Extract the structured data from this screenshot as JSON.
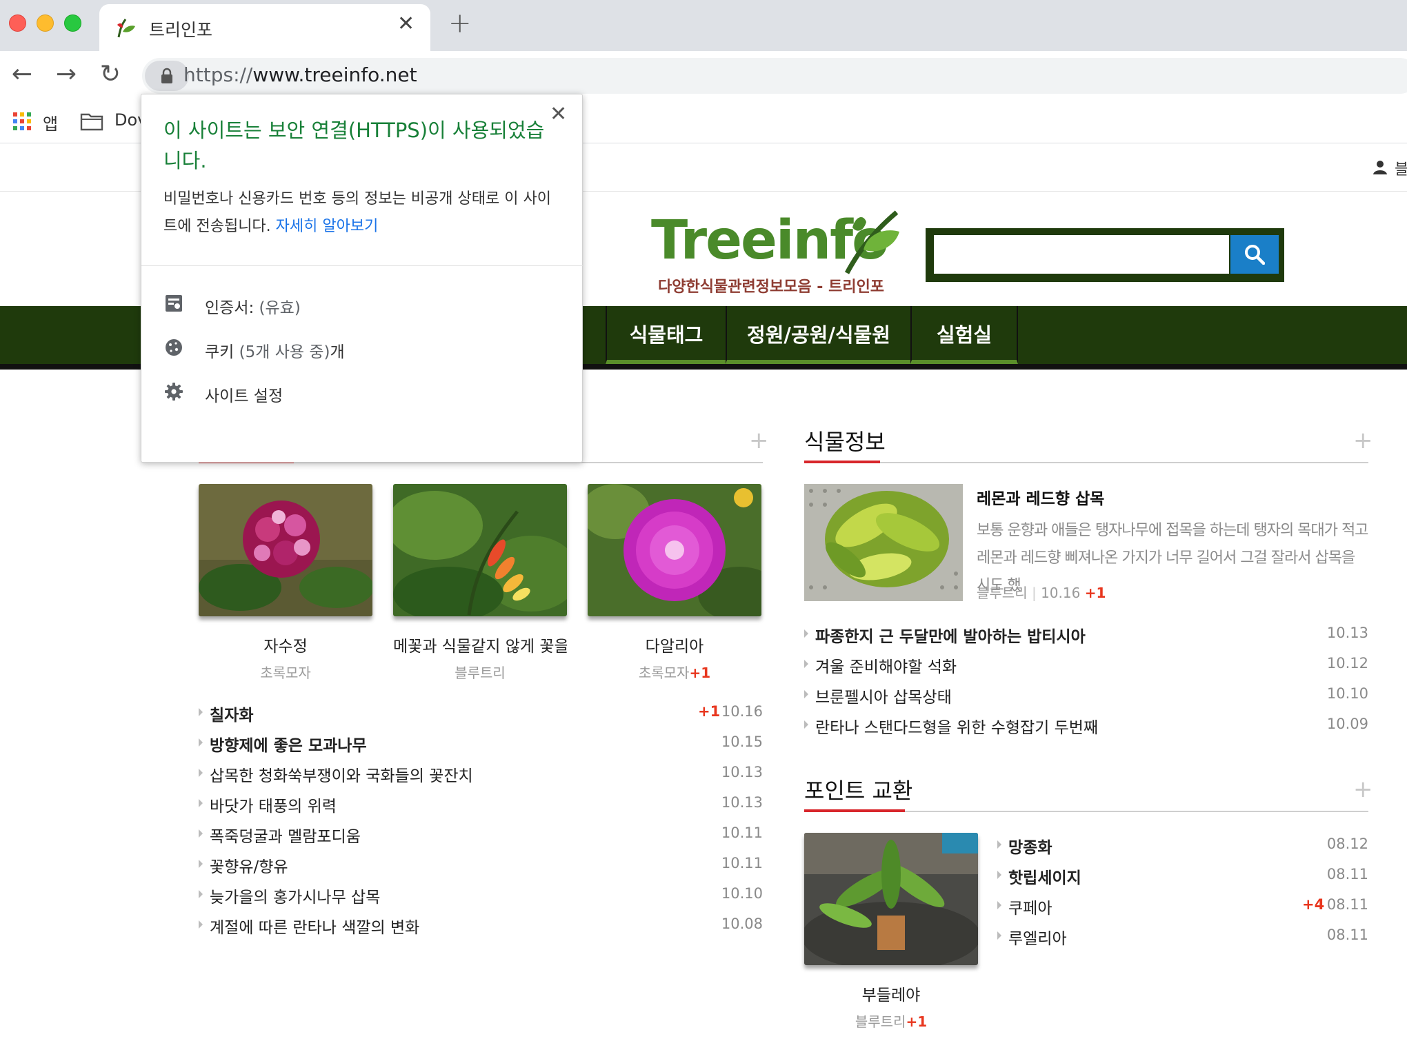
{
  "browser": {
    "tab_title": "트리인포",
    "url_scheme": "https://",
    "url_host": "www.treeinfo.net",
    "bookmarks": [
      {
        "label": "앱"
      },
      {
        "label": "Dov"
      }
    ]
  },
  "site": {
    "user_menu_label": "블",
    "logo_text": "Treeinfo",
    "logo_subtitle": "다양한식물관련정보모음 - 트리인포",
    "search": {
      "placeholder": ""
    },
    "nav": [
      "식물태그",
      "정원/공원/식물원",
      "실험실"
    ],
    "accent_color": "#d8262b",
    "nav_color": "#1f3a0c"
  },
  "left_section": {
    "plus": "+",
    "thumbs": [
      {
        "caption": "자수정",
        "author": "초록모자",
        "extra": ""
      },
      {
        "caption": "메꽃과 식물같지 않게 꽃을 피",
        "author": "블루트리",
        "extra": ""
      },
      {
        "caption": "다알리아",
        "author": "초록모자",
        "extra": "+1"
      }
    ],
    "items": [
      {
        "title": "칠자화",
        "date": "10.16",
        "extra": "+1",
        "bold": true
      },
      {
        "title": "방향제에 좋은 모과나무",
        "date": "10.15",
        "extra": "",
        "bold": true
      },
      {
        "title": "삽목한 청화쑥부쟁이와 국화들의 꽃잔치",
        "date": "10.13",
        "extra": "",
        "bold": false
      },
      {
        "title": "바닷가 태풍의 위력",
        "date": "10.13",
        "extra": "",
        "bold": false
      },
      {
        "title": "폭죽덩굴과 멜람포디움",
        "date": "10.11",
        "extra": "",
        "bold": false
      },
      {
        "title": "꽃향유/향유",
        "date": "10.11",
        "extra": "",
        "bold": false
      },
      {
        "title": "늦가을의 홍가시나무 삽목",
        "date": "10.10",
        "extra": "",
        "bold": false
      },
      {
        "title": "계절에 따른 란타나 색깔의 변화",
        "date": "10.08",
        "extra": "",
        "bold": false
      }
    ]
  },
  "plant_info": {
    "title": "식물정보",
    "plus": "+",
    "featured": {
      "title": "레몬과 레드향 삽목",
      "desc": "보통 운향과 애들은 탱자나무에 접목을 하는데 탱자의 목대가 적고 레몬과 레드향 삐져나온 가지가 너무 길어서 그걸 잘라서 삽목을 시도 했",
      "author": "블루트리",
      "sep": "|",
      "date": "10.16",
      "extra": "+1"
    },
    "items": [
      {
        "title": "파종한지 근 두달만에 발아하는 밥티시아",
        "date": "10.13",
        "bold": true
      },
      {
        "title": "겨울 준비해야할 석화",
        "date": "10.12",
        "bold": false
      },
      {
        "title": "브룬펠시아 삽목상태",
        "date": "10.10",
        "bold": false
      },
      {
        "title": "란타나 스탠다드형을 위한 수형잡기 두번째",
        "date": "10.09",
        "bold": false
      }
    ]
  },
  "points": {
    "title": "포인트 교환",
    "plus": "+",
    "thumb": {
      "caption": "부들레야",
      "author": "블루트리",
      "extra": "+1"
    },
    "items": [
      {
        "title": "망종화",
        "date": "08.12",
        "extra": "",
        "bold": true
      },
      {
        "title": "핫립세이지",
        "date": "08.11",
        "extra": "",
        "bold": true
      },
      {
        "title": "쿠페아",
        "date": "08.11",
        "extra": "+4",
        "bold": false
      },
      {
        "title": "루엘리아",
        "date": "08.11",
        "extra": "",
        "bold": false
      }
    ]
  },
  "security_popup": {
    "heading": "이 사이트는 보안 연결(HTTPS)이 사용되었습니다.",
    "body": "비밀번호나 신용카드 번호 등의 정보는 비공개 상태로 이 사이트에 전송됩니다.",
    "learn_more": "자세히 알아보기",
    "certificate_label": "인증서:",
    "certificate_status": "(유효)",
    "cookies_label": "쿠키",
    "cookies_status": "(5개 사용 중)",
    "cookies_suffix": "개",
    "site_settings_label": "사이트 설정",
    "heading_color": "#188038",
    "link_color": "#1a73e8"
  }
}
